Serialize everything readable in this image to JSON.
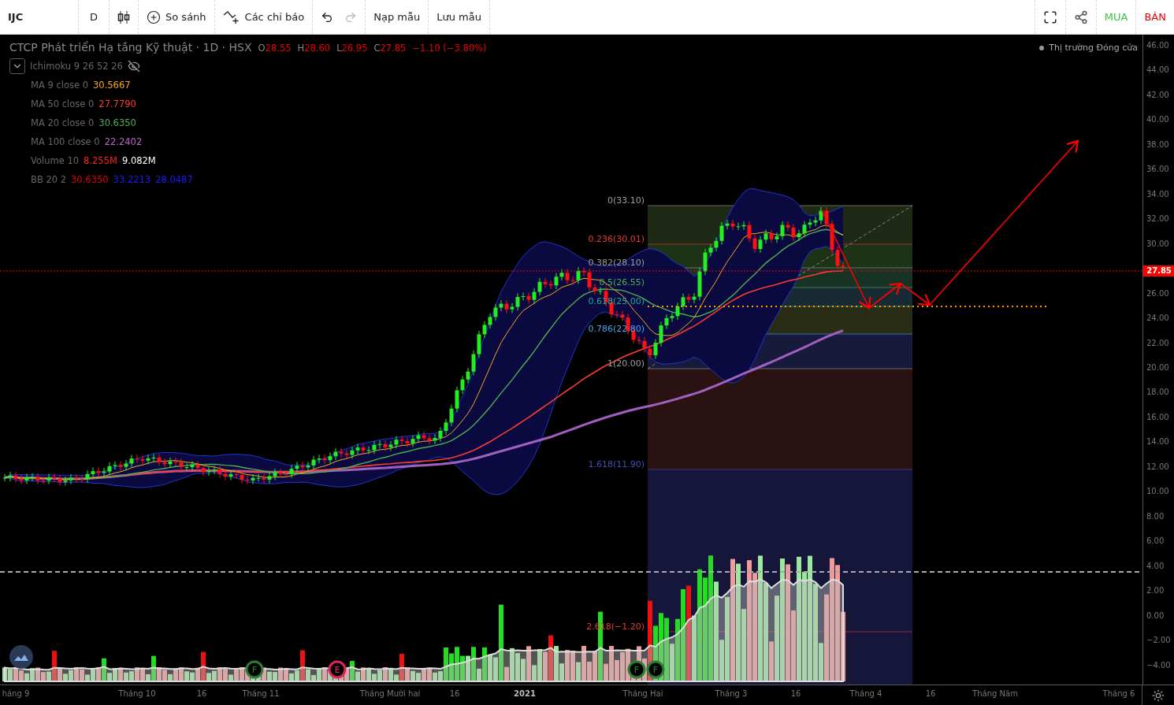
{
  "toolbar": {
    "symbol": "IJC",
    "interval": "D",
    "compare": "So sánh",
    "indicators": "Các chỉ báo",
    "load_template": "Nạp mẫu",
    "save_template": "Lưu mẫu",
    "buy": "MUA",
    "sell": "BÁN"
  },
  "legend": {
    "title": "CTCP Phát triển Hạ tầng Kỹ thuật · 1D · HSX",
    "ohlc": [
      {
        "label": "O",
        "value": "28.55"
      },
      {
        "label": "H",
        "value": "28.60"
      },
      {
        "label": "L",
        "value": "26.95"
      },
      {
        "label": "C",
        "value": "27.85"
      }
    ],
    "change": "−1.10 (−3.80%)",
    "indicators": [
      {
        "name": "Ichimoku 9 26 52 26",
        "hidden": true
      },
      {
        "name": "MA 9 close 0",
        "values": [
          {
            "text": "30.5667",
            "color": "#f5a623"
          }
        ]
      },
      {
        "name": "MA 50 close 0",
        "values": [
          {
            "text": "27.7790",
            "color": "#ff3b30"
          }
        ]
      },
      {
        "name": "MA 20 close 0",
        "values": [
          {
            "text": "30.6350",
            "color": "#4caf50"
          }
        ]
      },
      {
        "name": "MA 100 close 0",
        "values": [
          {
            "text": "22.2402",
            "color": "#ba68c8"
          }
        ]
      },
      {
        "name": "Volume 10",
        "values": [
          {
            "text": "8.255M",
            "color": "#ff2020"
          },
          {
            "text": "9.082M",
            "color": "#ffffff"
          }
        ]
      },
      {
        "name": "BB 20 2",
        "values": [
          {
            "text": "30.6350",
            "color": "#e00000"
          },
          {
            "text": "33.2213",
            "color": "#1a1aff"
          },
          {
            "text": "28.0487",
            "color": "#1a1aff"
          }
        ]
      }
    ]
  },
  "market_status": "Thị trường Đóng cửa",
  "fib_levels": [
    {
      "label": "0(33.10)",
      "color": "#9e9e9e"
    },
    {
      "label": "0.236(30.01)",
      "color": "#e53935"
    },
    {
      "label": "0.382(28.10)",
      "color": "#9e9e9e"
    },
    {
      "label": "0.5(26.55)",
      "color": "#4caf50"
    },
    {
      "label": "0.618(25.00)",
      "color": "#26a69a"
    },
    {
      "label": "0.786(22.80)",
      "color": "#42a5f5"
    },
    {
      "label": "1(20.00)",
      "color": "#9e9e9e"
    },
    {
      "label": "1.618(11.90)",
      "color": "#3f51b5"
    },
    {
      "label": "2.618(−1.20)",
      "color": "#e53935"
    }
  ],
  "event_markers": [
    {
      "text": "F",
      "color": "#2e7d32"
    },
    {
      "text": "E",
      "color": "#e0245e"
    },
    {
      "text": "F",
      "color": "#2e7d32"
    },
    {
      "text": "F",
      "color": "#2e7d32"
    }
  ],
  "price_axis": [
    "46.00",
    "44.00",
    "42.00",
    "40.00",
    "38.00",
    "36.00",
    "34.00",
    "32.00",
    "30.00",
    "26.00",
    "24.00",
    "22.00",
    "20.00",
    "18.00",
    "16.00",
    "14.00",
    "12.00",
    "10.00",
    "8.00",
    "6.00",
    "4.00",
    "2.00",
    "0.00",
    "−2.00",
    "−4.00"
  ],
  "last_price": "27.85",
  "time_axis": [
    {
      "text": "háng 9",
      "year": false
    },
    {
      "text": "Tháng 10",
      "year": false
    },
    {
      "text": "16",
      "year": false
    },
    {
      "text": "Tháng 11",
      "year": false
    },
    {
      "text": "Tháng Mười hai",
      "year": false
    },
    {
      "text": "16",
      "year": false
    },
    {
      "text": "2021",
      "year": true
    },
    {
      "text": "Tháng Hai",
      "year": false
    },
    {
      "text": "Tháng 3",
      "year": false
    },
    {
      "text": "16",
      "year": false
    },
    {
      "text": "Tháng 4",
      "year": false
    },
    {
      "text": "16",
      "year": false
    },
    {
      "text": "Tháng Năm",
      "year": false
    },
    {
      "text": "Tháng 6",
      "year": false
    }
  ]
}
